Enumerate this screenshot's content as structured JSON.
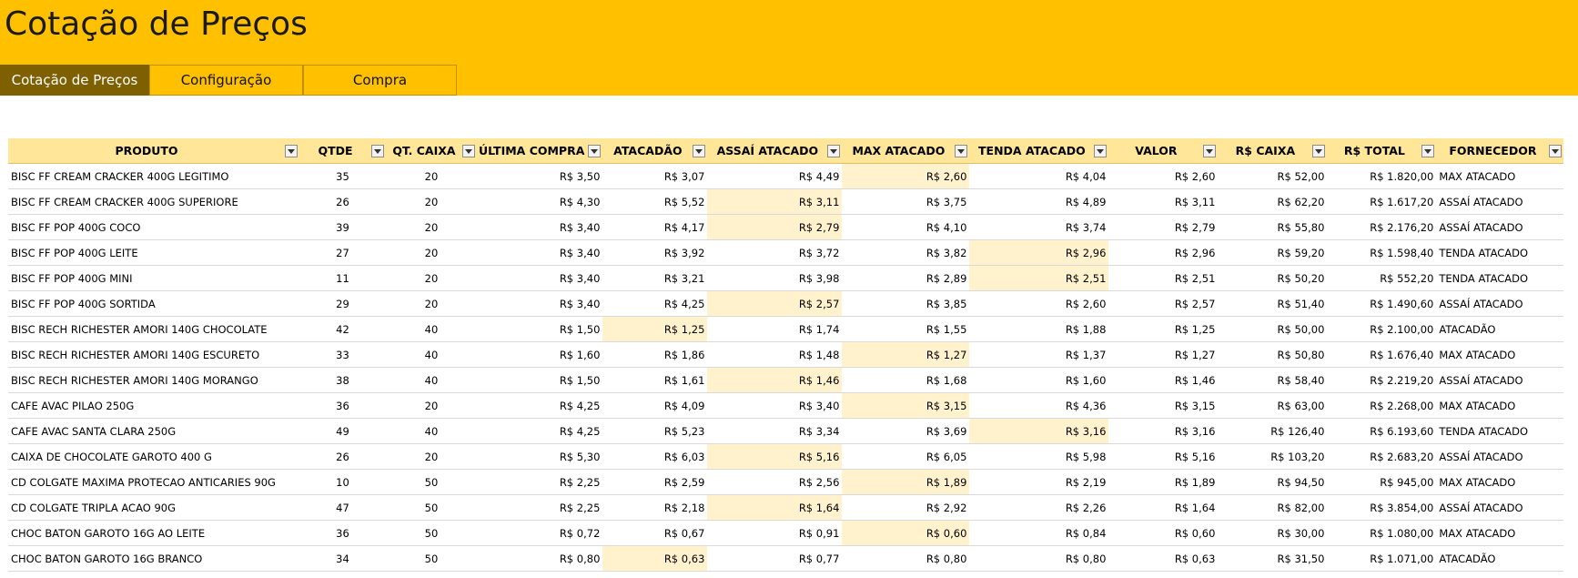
{
  "app_title": "Cotação de Preços",
  "tabs": [
    {
      "label": "Cotação de Preços",
      "active": true
    },
    {
      "label": "Configuração",
      "active": false
    },
    {
      "label": "Compra",
      "active": false
    }
  ],
  "colors": {
    "accent": "#FFC000",
    "active_tab": "#7F6000",
    "header_fill": "#FFE699",
    "best_price_fill": "#FFF2CC"
  },
  "table": {
    "columns": [
      "PRODUTO",
      "QTDE",
      "QT. CAIXA",
      "ÚLTIMA COMPRA",
      "ATACADÃO",
      "ASSAÍ ATACADO",
      "MAX ATACADO",
      "TENDA ATACADO",
      "VALOR",
      "R$ CAIXA",
      "R$ TOTAL",
      "FORNECEDOR"
    ],
    "rows": [
      {
        "cells": [
          "BISC FF CREAM CRACKER 400G LEGITIMO",
          "35",
          "20",
          "R$ 3,50",
          "R$ 3,07",
          "R$ 4,49",
          "R$ 2,60",
          "R$ 4,04",
          "R$ 2,60",
          "R$ 52,00",
          "R$ 1.820,00",
          "MAX ATACADO"
        ],
        "highlight": 6
      },
      {
        "cells": [
          "BISC FF CREAM CRACKER 400G SUPERIORE",
          "26",
          "20",
          "R$ 4,30",
          "R$ 5,52",
          "R$ 3,11",
          "R$ 3,75",
          "R$ 4,89",
          "R$ 3,11",
          "R$ 62,20",
          "R$ 1.617,20",
          "ASSAÍ ATACADO"
        ],
        "highlight": 5
      },
      {
        "cells": [
          "BISC FF POP  400G COCO",
          "39",
          "20",
          "R$ 3,40",
          "R$ 4,17",
          "R$ 2,79",
          "R$ 4,10",
          "R$ 3,74",
          "R$ 2,79",
          "R$ 55,80",
          "R$ 2.176,20",
          "ASSAÍ ATACADO"
        ],
        "highlight": 5
      },
      {
        "cells": [
          "BISC FF POP  400G LEITE",
          "27",
          "20",
          "R$ 3,40",
          "R$ 3,92",
          "R$ 3,72",
          "R$ 3,82",
          "R$ 2,96",
          "R$ 2,96",
          "R$ 59,20",
          "R$ 1.598,40",
          "TENDA ATACADO"
        ],
        "highlight": 7
      },
      {
        "cells": [
          "BISC FF POP  400G MINI",
          "11",
          "20",
          "R$ 3,40",
          "R$ 3,21",
          "R$ 3,98",
          "R$ 2,89",
          "R$ 2,51",
          "R$ 2,51",
          "R$ 50,20",
          "R$ 552,20",
          "TENDA ATACADO"
        ],
        "highlight": 7
      },
      {
        "cells": [
          "BISC FF POP  400G SORTIDA",
          "29",
          "20",
          "R$ 3,40",
          "R$ 4,25",
          "R$ 2,57",
          "R$ 3,85",
          "R$ 2,60",
          "R$ 2,57",
          "R$ 51,40",
          "R$ 1.490,60",
          "ASSAÍ ATACADO"
        ],
        "highlight": 5
      },
      {
        "cells": [
          "BISC RECH RICHESTER AMORI 140G CHOCOLATE",
          "42",
          "40",
          "R$ 1,50",
          "R$ 1,25",
          "R$ 1,74",
          "R$ 1,55",
          "R$ 1,88",
          "R$ 1,25",
          "R$ 50,00",
          "R$ 2.100,00",
          "ATACADÃO"
        ],
        "highlight": 4
      },
      {
        "cells": [
          "BISC RECH RICHESTER AMORI 140G ESCURETO",
          "33",
          "40",
          "R$ 1,60",
          "R$ 1,86",
          "R$ 1,48",
          "R$ 1,27",
          "R$ 1,37",
          "R$ 1,27",
          "R$ 50,80",
          "R$ 1.676,40",
          "MAX ATACADO"
        ],
        "highlight": 6
      },
      {
        "cells": [
          "BISC RECH RICHESTER AMORI 140G MORANGO",
          "38",
          "40",
          "R$ 1,50",
          "R$ 1,61",
          "R$ 1,46",
          "R$ 1,68",
          "R$ 1,60",
          "R$ 1,46",
          "R$ 58,40",
          "R$ 2.219,20",
          "ASSAÍ ATACADO"
        ],
        "highlight": 5
      },
      {
        "cells": [
          "CAFE AVAC PILAO 250G",
          "36",
          "20",
          "R$ 4,25",
          "R$ 4,09",
          "R$ 3,40",
          "R$ 3,15",
          "R$ 4,36",
          "R$ 3,15",
          "R$ 63,00",
          "R$ 2.268,00",
          "MAX ATACADO"
        ],
        "highlight": 6
      },
      {
        "cells": [
          "CAFE AVAC SANTA CLARA 250G",
          "49",
          "40",
          "R$ 4,25",
          "R$ 5,23",
          "R$ 3,34",
          "R$ 3,69",
          "R$ 3,16",
          "R$ 3,16",
          "R$ 126,40",
          "R$ 6.193,60",
          "TENDA ATACADO"
        ],
        "highlight": 7
      },
      {
        "cells": [
          "CAIXA DE CHOCOLATE GAROTO 400 G",
          "26",
          "20",
          "R$ 5,30",
          "R$ 6,03",
          "R$ 5,16",
          "R$ 6,05",
          "R$ 5,98",
          "R$ 5,16",
          "R$ 103,20",
          "R$ 2.683,20",
          "ASSAÍ ATACADO"
        ],
        "highlight": 5
      },
      {
        "cells": [
          "CD COLGATE MAXIMA PROTECAO ANTICARIES 90G",
          "10",
          "50",
          "R$ 2,25",
          "R$ 2,59",
          "R$ 2,56",
          "R$ 1,89",
          "R$ 2,19",
          "R$ 1,89",
          "R$ 94,50",
          "R$ 945,00",
          "MAX ATACADO"
        ],
        "highlight": 6
      },
      {
        "cells": [
          "CD COLGATE TRIPLA ACAO 90G",
          "47",
          "50",
          "R$ 2,25",
          "R$ 2,18",
          "R$ 1,64",
          "R$ 2,92",
          "R$ 2,26",
          "R$ 1,64",
          "R$ 82,00",
          "R$ 3.854,00",
          "ASSAÍ ATACADO"
        ],
        "highlight": 5
      },
      {
        "cells": [
          "CHOC BATON GAROTO 16G AO LEITE",
          "36",
          "50",
          "R$ 0,72",
          "R$ 0,67",
          "R$ 0,91",
          "R$ 0,60",
          "R$ 0,84",
          "R$ 0,60",
          "R$ 30,00",
          "R$ 1.080,00",
          "MAX ATACADO"
        ],
        "highlight": 6
      },
      {
        "cells": [
          "CHOC BATON GAROTO 16G BRANCO",
          "34",
          "50",
          "R$ 0,80",
          "R$ 0,63",
          "R$ 0,77",
          "R$ 0,80",
          "R$ 0,80",
          "R$ 0,63",
          "R$ 31,50",
          "R$ 1.071,00",
          "ATACADÃO"
        ],
        "highlight": 4
      }
    ]
  }
}
